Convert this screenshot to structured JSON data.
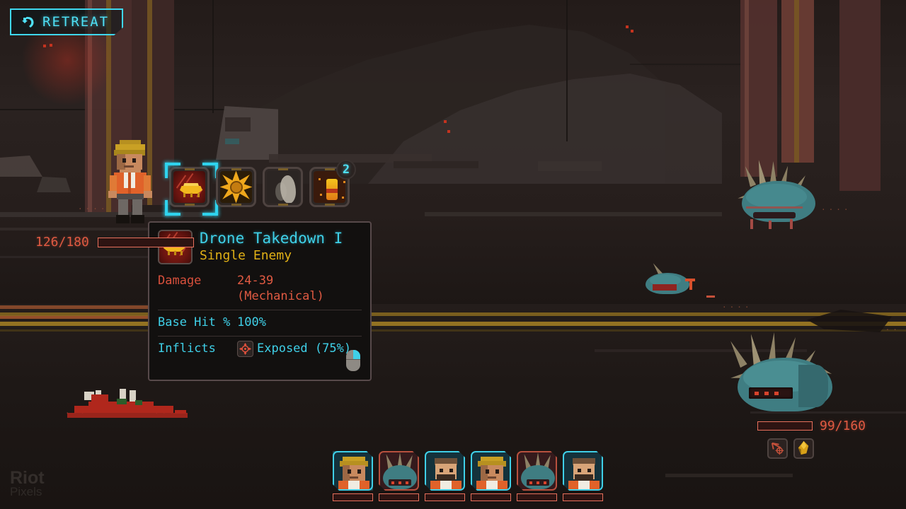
{
  "hud": {
    "retreat": {
      "label": "RETREAT",
      "icon": "back-arrow-icon",
      "color": "#4ee0f5"
    }
  },
  "abilities": [
    {
      "name": "drone-takedown",
      "icon": "drone-strike-icon",
      "selected": true,
      "count": ""
    },
    {
      "name": "burst",
      "icon": "explosion-burst-icon",
      "selected": false,
      "count": ""
    },
    {
      "name": "smoke",
      "icon": "smoke-cloud-icon",
      "selected": false,
      "count": ""
    },
    {
      "name": "stimpack",
      "icon": "potion-bottle-icon",
      "selected": false,
      "count": "2"
    }
  ],
  "tooltip": {
    "icon": "drone-strike-icon",
    "title": "Drone Takedown I",
    "subtitle": "Single Enemy",
    "rows": [
      {
        "label": "Damage",
        "value": "24-39"
      },
      {
        "label": "",
        "value": "(Mechanical)"
      }
    ],
    "hit_label": "Base Hit %",
    "hit_value": "100%",
    "inflicts_label": "Inflicts",
    "inflicts_icon": "exposed-crosshair-icon",
    "inflicts_value": "Exposed (75%)",
    "mouse_hint": "right-mouse-icon"
  },
  "player": {
    "hp_text": "126/180",
    "hp_percent": 70
  },
  "enemy": {
    "hp_text": "99/160",
    "hp_percent": 62,
    "effects": [
      {
        "name": "marked-crosshair-icon"
      },
      {
        "name": "gold-shard-icon"
      }
    ]
  },
  "turn_order": [
    {
      "name": "turn-portrait-hero",
      "side": "ally",
      "active": true,
      "hp_percent": 70
    },
    {
      "name": "turn-portrait-enemy-1",
      "side": "enemy",
      "active": false,
      "hp_percent": 65
    },
    {
      "name": "turn-portrait-ally-2",
      "side": "ally",
      "active": false,
      "hp_percent": 62
    },
    {
      "name": "turn-portrait-ally-3",
      "side": "ally",
      "active": false,
      "hp_percent": 70
    },
    {
      "name": "turn-portrait-enemy-2",
      "side": "enemy",
      "active": false,
      "hp_percent": 55
    },
    {
      "name": "turn-portrait-ally-4",
      "side": "ally",
      "active": false,
      "hp_percent": 58
    }
  ],
  "watermark": {
    "line1": "Riot",
    "line2": "Pixels"
  },
  "palette": {
    "cyan": "#3fd0e8",
    "yellow": "#e0b016",
    "red": "#e05a42",
    "enemy_teal": "#3f7d82",
    "bone": "#8e8266"
  }
}
